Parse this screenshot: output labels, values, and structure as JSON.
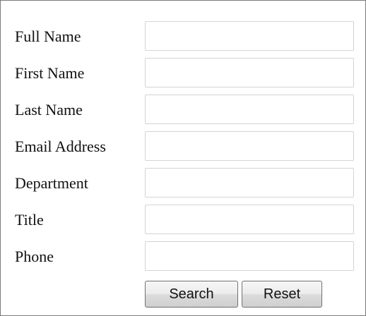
{
  "form": {
    "fields": [
      {
        "label": "Full Name",
        "value": "",
        "placeholder": ""
      },
      {
        "label": "First Name",
        "value": "",
        "placeholder": ""
      },
      {
        "label": "Last Name",
        "value": "",
        "placeholder": ""
      },
      {
        "label": "Email Address",
        "value": "",
        "placeholder": ""
      },
      {
        "label": "Department",
        "value": "",
        "placeholder": ""
      },
      {
        "label": "Title",
        "value": "",
        "placeholder": ""
      },
      {
        "label": "Phone",
        "value": "",
        "placeholder": ""
      }
    ],
    "buttons": {
      "search_label": "Search",
      "reset_label": "Reset"
    }
  }
}
